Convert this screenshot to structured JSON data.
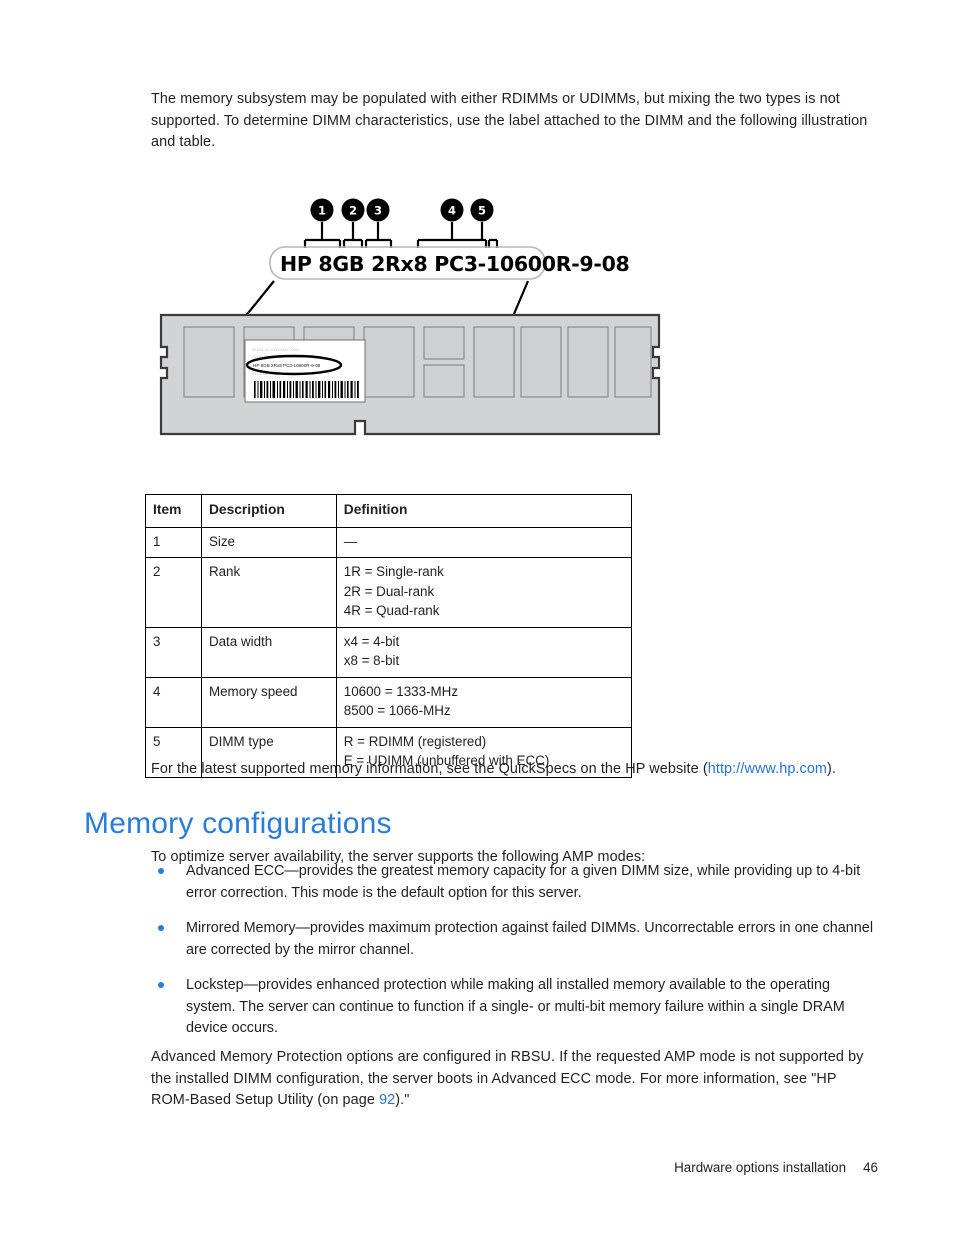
{
  "document": {
    "intro_paragraph": "The memory subsystem may be populated with either RDIMMs or UDIMMs, but mixing the two types is not supported. To determine DIMM characteristics, use the label attached to the DIMM and the following illustration and table.",
    "quickspecs_paragraph_before": "For the latest supported memory information, see the QuickSpecs on the HP website (",
    "quickspecs_link": "http://www.hp.com",
    "quickspecs_paragraph_after": ").",
    "heading": "Memory configurations",
    "lead_paragraph": "To optimize server availability, the server supports the following AMP modes:",
    "amp_paragraph_before": "Advanced Memory Protection options are configured in RBSU. If the requested AMP mode is not supported by the installed DIMM configuration, the server boots in Advanced ECC mode. For more information, see \"HP ROM-Based Setup Utility (on page ",
    "amp_page_link": "92",
    "amp_paragraph_after": ").\""
  },
  "amp_modes": [
    "Advanced ECC—provides the greatest memory capacity for a given DIMM size, while providing up to 4-bit error correction.   This mode is the default option for this server.",
    "Mirrored Memory—provides maximum protection against failed DIMMs. Uncorrectable errors in one channel are corrected by the mirror channel.",
    "Lockstep—provides enhanced protection while making all installed memory available to the operating system. The server can continue to function if a single- or multi-bit memory failure within a single DRAM device occurs."
  ],
  "figure": {
    "label_full": "HP 8GB 2Rx8 PC3-10600R-9-08",
    "label_parts": {
      "vendor": "HP",
      "size": "8GB",
      "rank": "2R",
      "x": "x",
      "width": "8",
      "type_prefix": "PC3-",
      "speed": "10600",
      "dimm_type": "R",
      "suffix": "-9-08"
    },
    "callouts": [
      "1",
      "2",
      "3",
      "4",
      "5"
    ],
    "dimm_small_label": "HP 8GB 2Rx8 PC3-10600R-9-08",
    "ghost_lines": [
      "xxxxx xx xxxxxxxx xxxx",
      "xxxxxxxxxxxxxx xxxxxxxx",
      "xxxx xxxxxxx"
    ]
  },
  "table": {
    "headers": [
      "Item",
      "Description",
      "Definition"
    ],
    "rows": [
      {
        "item": "1",
        "description": "Size",
        "definition": [
          "—"
        ]
      },
      {
        "item": "2",
        "description": "Rank",
        "definition": [
          "1R = Single-rank",
          "2R = Dual-rank",
          "4R = Quad-rank"
        ]
      },
      {
        "item": "3",
        "description": "Data width",
        "definition": [
          "x4 = 4-bit",
          "x8 = 8-bit"
        ]
      },
      {
        "item": "4",
        "description": "Memory speed",
        "definition": [
          "10600 = 1333-MHz",
          "8500 = 1066-MHz"
        ]
      },
      {
        "item": "5",
        "description": "DIMM type",
        "definition": [
          "R = RDIMM (registered)",
          "E = UDIMM (unbuffered with ECC)"
        ]
      }
    ]
  },
  "footer": {
    "section": "Hardware options installation",
    "page_number": "46"
  },
  "colors": {
    "link": "#2a72d4",
    "heading": "#2b7cd6",
    "bullet": "#2b7cd6",
    "text": "#231f20",
    "dimm_body": "#d2d3d5",
    "dimm_chip": "#cfd0d2"
  }
}
